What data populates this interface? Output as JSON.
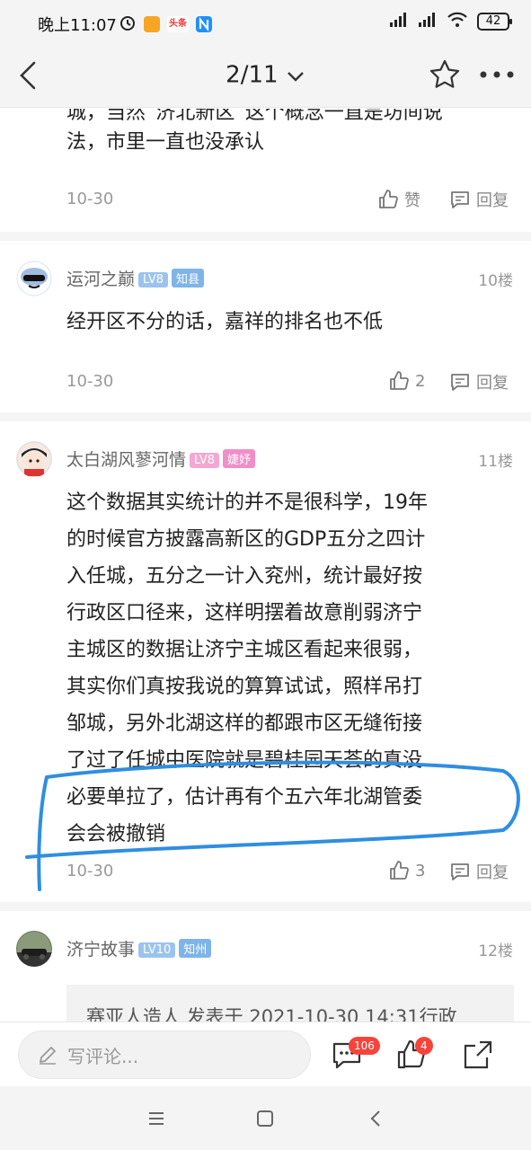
{
  "status": {
    "time": "晚上11:07",
    "app_badge": "头条",
    "battery": "42"
  },
  "nav": {
    "page_indicator": "2/11"
  },
  "posts": {
    "tail": {
      "line1": "城，当然“济北新区”这个概念一直是坊间说",
      "line2": "法，市里一直也没承认",
      "date": "10-30",
      "like_label": "赞",
      "reply_label": "回复"
    },
    "p10": {
      "username": "运河之巅",
      "level": "LV8",
      "title": "知县",
      "floor": "10楼",
      "text": "经开区不分的话，嘉祥的排名也不低",
      "date": "10-30",
      "likes": "2",
      "reply_label": "回复"
    },
    "p11": {
      "username": "太白湖风蓼河情",
      "level": "LV8",
      "title": "婕妤",
      "floor": "11楼",
      "lines": [
        "这个数据其实统计的并不是很科学，19年",
        "的时候官方披露高新区的GDP五分之四计",
        "入任城，五分之一计入兖州，统计最好按",
        "行政区口径来，这样明摆着故意削弱济宁",
        "主城区的数据让济宁主城区看起来很弱，",
        "其实你们真按我说的算算试试，照样吊打",
        "邹城，另外北湖这样的都跟市区无缝衔接",
        "了过了任城中医院就是碧桂园天荟的真没",
        "必要单拉了，估计再有个五六年北湖管委",
        "会会被撤销"
      ],
      "date": "10-30",
      "likes": "3",
      "reply_label": "回复"
    },
    "p12": {
      "username": "济宁故事",
      "level": "LV10",
      "title": "知州",
      "floor": "12楼",
      "quote": "赛亚人造人 发表于 2021-10-30 14:31行政"
    }
  },
  "bottom": {
    "comment_placeholder": "写评论...",
    "comment_count": "106",
    "like_count": "4"
  },
  "colors": {
    "lv_badge": "#9cc3ee",
    "title_badge_blue": "#7fb4e8",
    "title_badge_pink": "#f08fc7",
    "lv_badge_pink": "#f4a7d2",
    "highlight_stroke": "#2f8ee0",
    "red_badge": "#f5443b"
  }
}
